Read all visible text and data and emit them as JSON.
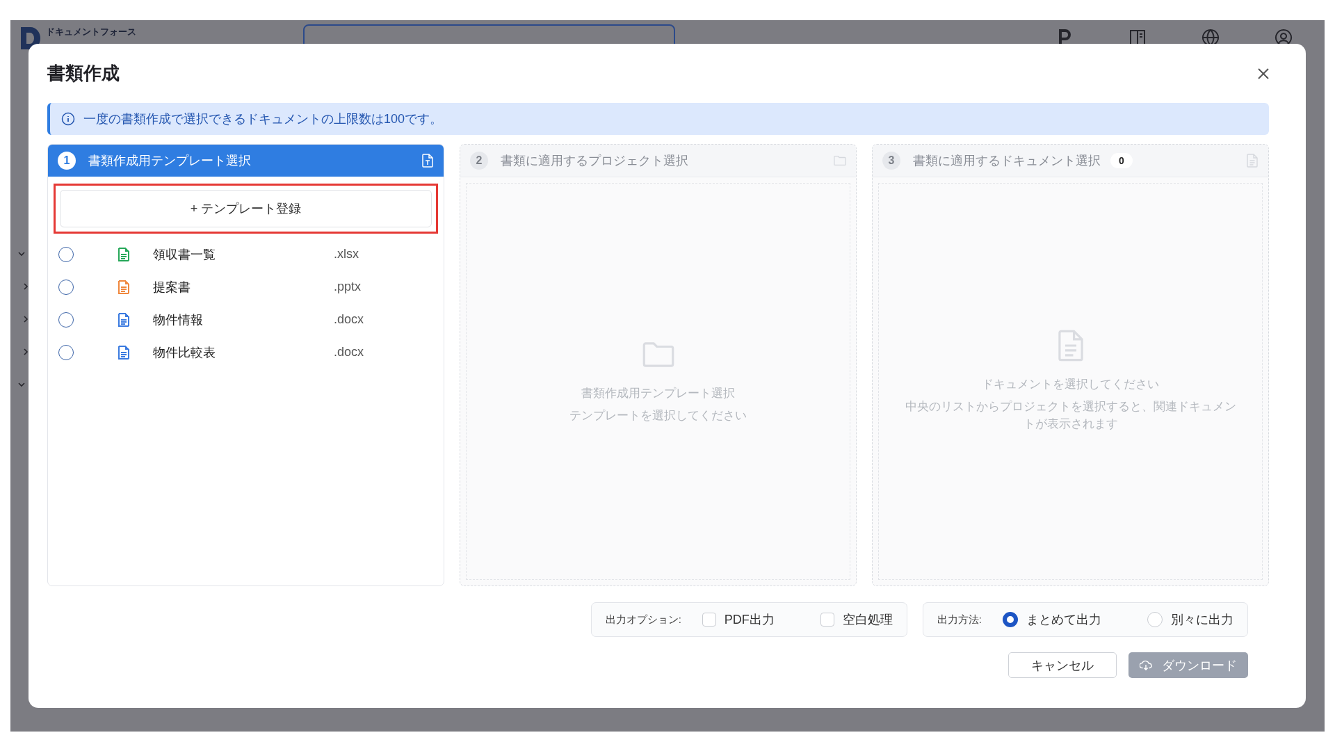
{
  "backdrop": {
    "logo_text": "ドキュメントフォース",
    "sidebar_chevrons": [
      {
        "expanded": true
      },
      {
        "expanded": false
      },
      {
        "expanded": false
      },
      {
        "expanded": false
      },
      {
        "expanded": true
      }
    ]
  },
  "dialog": {
    "title": "書類作成",
    "info": "一度の書類作成で選択できるドキュメントの上限数は100です。",
    "steps": [
      {
        "number": "1",
        "title": "書類作成用テンプレート選択",
        "active": true,
        "kind": "template"
      },
      {
        "number": "2",
        "title": "書類に適用するプロジェクト選択",
        "active": false,
        "kind": "project",
        "empty_title": "書類作成用テンプレート選択",
        "empty_text": "テンプレートを選択してください"
      },
      {
        "number": "3",
        "title": "書類に適用するドキュメント選択",
        "active": false,
        "kind": "document",
        "count": "0",
        "empty_title": "ドキュメントを選択してください",
        "empty_text": "中央のリストからプロジェクトを選択すると、関連ドキュメントが表示されます"
      }
    ],
    "register_button": "+ テンプレート登録",
    "templates": [
      {
        "name": "領収書一覧",
        "ext": ".xlsx",
        "color": "#27a85a",
        "selected": false
      },
      {
        "name": "提案書",
        "ext": ".pptx",
        "color": "#f0883e",
        "selected": false
      },
      {
        "name": "物件情報",
        "ext": ".docx",
        "color": "#3b7be0",
        "selected": false
      },
      {
        "name": "物件比較表",
        "ext": ".docx",
        "color": "#3b7be0",
        "selected": false
      }
    ],
    "output_options": {
      "label": "出力オプション:",
      "items": [
        {
          "label": "PDF出力",
          "checked": false
        },
        {
          "label": "空白処理",
          "checked": false
        }
      ]
    },
    "output_method": {
      "label": "出力方法:",
      "items": [
        {
          "label": "まとめて出力",
          "selected": true
        },
        {
          "label": "別々に出力",
          "selected": false
        }
      ]
    },
    "cancel_button": "キャンセル",
    "download_button": {
      "label": "ダウンロード",
      "disabled": true
    }
  }
}
